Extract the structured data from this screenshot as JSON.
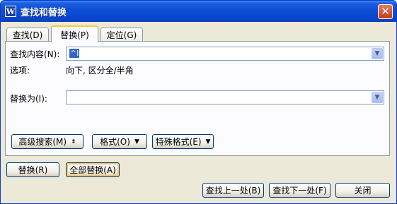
{
  "window": {
    "title": "查找和替换",
    "app_icon_letter": "W",
    "close_glyph": "✕"
  },
  "tabs": [
    {
      "label": "查找(D)",
      "active": false
    },
    {
      "label": "替换(P)",
      "active": true
    },
    {
      "label": "定位(G)",
      "active": false
    }
  ],
  "find": {
    "label": "查找内容(N):",
    "value": "^l"
  },
  "options": {
    "label": "选项:",
    "value": "向下, 区分全/半角"
  },
  "replace": {
    "label": "替换为(I):",
    "value": ""
  },
  "toolbar": {
    "advanced_search": "高级搜索(M)",
    "advanced_search_glyph": "⇟",
    "format": "格式(O)",
    "special_format": "特殊格式(E)",
    "dropdown_glyph": "▼"
  },
  "actions": {
    "replace": "替换(R)",
    "replace_all": "全部替换(A)",
    "find_prev": "查找上一处(B)",
    "find_next": "查找下一处(F)",
    "close": "关闭"
  },
  "colors": {
    "titlebar": "#0a46cf",
    "dialog_bg": "#ece9d8",
    "selection": "#316ac5",
    "focus_ring": "#f7c664"
  }
}
